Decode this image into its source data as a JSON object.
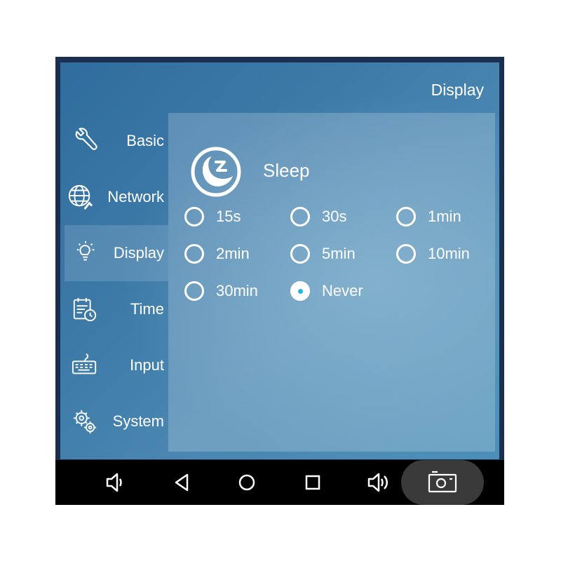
{
  "header": {
    "title": "Display"
  },
  "sidebar": {
    "items": [
      {
        "label": "Basic",
        "icon": "wrench-icon"
      },
      {
        "label": "Network",
        "icon": "globe-network-icon"
      },
      {
        "label": "Display",
        "icon": "lightbulb-icon",
        "active": true
      },
      {
        "label": "Time",
        "icon": "calendar-clock-icon"
      },
      {
        "label": "Input",
        "icon": "keyboard-icon"
      },
      {
        "label": "System",
        "icon": "gears-icon"
      }
    ]
  },
  "sleep": {
    "title": "Sleep",
    "icon": "sleep-moon-icon",
    "options": [
      "15s",
      "30s",
      "1min",
      "2min",
      "5min",
      "10min",
      "30min",
      "Never"
    ],
    "selected": "Never"
  },
  "navbar": {
    "icons": [
      "volume-down-icon",
      "back-icon",
      "home-icon",
      "recents-icon",
      "volume-up-icon",
      "screenshot-icon"
    ]
  },
  "colors": {
    "accent": "#27b7d8",
    "navbar": "#000000",
    "screenshot_pill": "#3a3a3a"
  }
}
